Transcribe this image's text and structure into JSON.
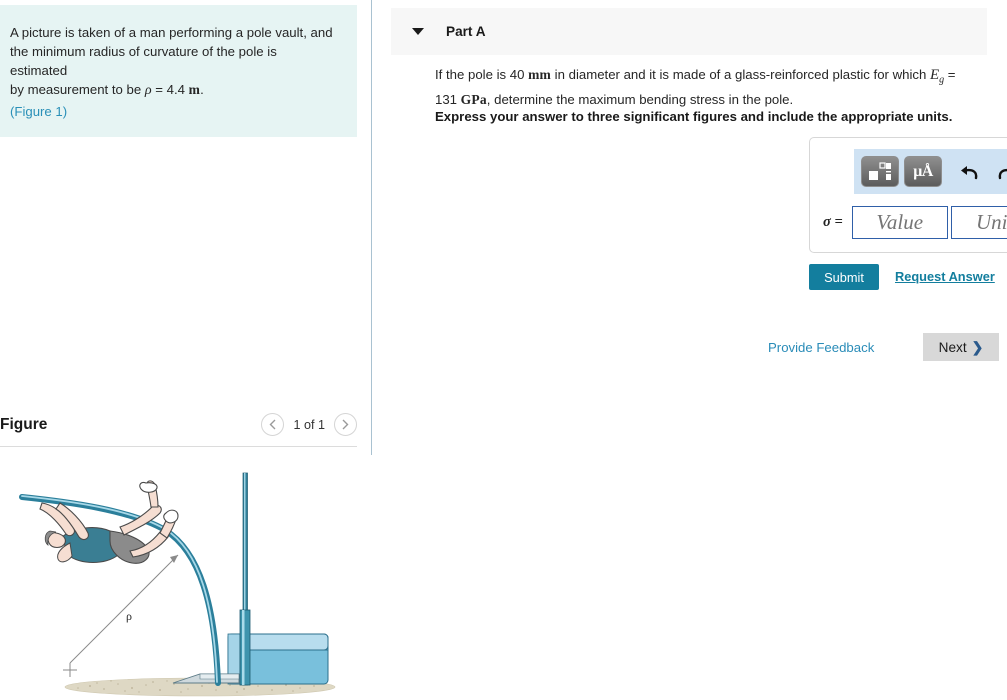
{
  "left": {
    "problem": {
      "line1": "A picture is taken of a man performing a pole vault, and",
      "line2": "the minimum radius of curvature of the pole is estimated",
      "line3_pre": "by measurement to be ",
      "rho_symbol": "ρ",
      "equals": " = ",
      "rho_value": "4.4",
      "rho_unit": "m",
      "period": ".",
      "figure_link": "(Figure 1)"
    },
    "figure": {
      "title": "Figure",
      "counter": "1 of 1",
      "prev_icon": "chevron-left-icon",
      "next_icon": "chevron-right-icon",
      "rho_label": "ρ"
    }
  },
  "right": {
    "part": {
      "caret_icon": "caret-down-icon",
      "title": "Part A"
    },
    "question": {
      "seg1": "If the pole is 40 ",
      "unit_mm": "mm",
      "seg2": " in diameter and it is made of a glass-reinforced plastic for which ",
      "var_E": "E",
      "var_E_sub": "g",
      "seg3": " = 131 ",
      "unit_GPa": "GPa",
      "seg4": ", determine the maximum bending stress in the pole."
    },
    "instruction": "Express your answer to three significant figures and include the appropriate units.",
    "toolbar": {
      "template_icon": "math-template-icon",
      "units_icon": "micro-angstrom-units-icon",
      "units_label": "μÅ",
      "undo_icon": "undo-arrow-icon",
      "undo_glyph": "⮐",
      "redo_icon": "redo-arrow-icon",
      "redo_glyph": "⮑",
      "reset_icon": "reset-circular-arrow-icon",
      "reset_glyph": "↻",
      "keyboard_icon": "keyboard-icon",
      "help_icon": "help-question-icon",
      "help_glyph": "?"
    },
    "answer": {
      "sigma_label": "σ =",
      "value_placeholder": "Value",
      "value": "",
      "units_placeholder": "Units",
      "units": ""
    },
    "submit_label": "Submit",
    "request_answer_label": "Request Answer",
    "provide_feedback_label": "Provide Feedback",
    "next_label": "Next",
    "next_chevron": "❯"
  },
  "colors": {
    "problem_bg": "#e6f4f3",
    "link": "#2a90b8",
    "submit_bg": "#137e9e",
    "toolbar_bg": "#cfe2f3",
    "input_border": "#2f5fa8",
    "next_bg": "#d8d8d8",
    "pole_teal": "#3e94ad",
    "mat_blue": "#79c0dc",
    "sand": "#ded8c4",
    "skin": "#f6ded2",
    "shorts_teal": "#3a7e93",
    "shorts_gray": "#8b8b8b"
  }
}
